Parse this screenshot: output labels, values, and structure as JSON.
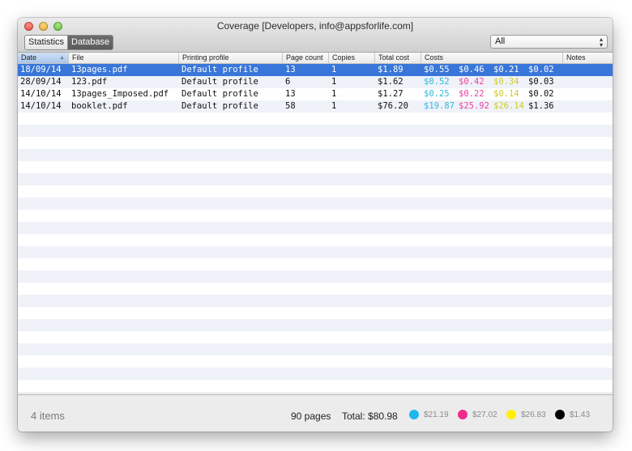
{
  "window": {
    "title": "Coverage [Developers, info@appsforlife.com]"
  },
  "toolbar": {
    "segments": [
      {
        "label": "Statistics",
        "selected": false
      },
      {
        "label": "Database",
        "selected": true
      }
    ],
    "filter": {
      "selected": "All"
    }
  },
  "table": {
    "columns": [
      {
        "label": "Date",
        "sorted": "ascending"
      },
      {
        "label": "File"
      },
      {
        "label": "Printing profile"
      },
      {
        "label": "Page count"
      },
      {
        "label": "Copies"
      },
      {
        "label": "Total cost"
      },
      {
        "label": "Costs"
      },
      {
        "label": "Notes"
      }
    ],
    "rows": [
      {
        "date": "18/09/14",
        "file": "13pages.pdf",
        "profile": "Default profile",
        "pages": "13",
        "copies": "1",
        "total": "$1.89",
        "cyan": "$0.55",
        "magenta": "$0.46",
        "yellow": "$0.21",
        "black": "$0.02",
        "notes": "",
        "selected": true
      },
      {
        "date": "28/09/14",
        "file": "123.pdf",
        "profile": "Default profile",
        "pages": "6",
        "copies": "1",
        "total": "$1.62",
        "cyan": "$0.52",
        "magenta": "$0.42",
        "yellow": "$0.34",
        "black": "$0.03",
        "notes": ""
      },
      {
        "date": "14/10/14",
        "file": "13pages_Imposed.pdf",
        "profile": "Default profile",
        "pages": "13",
        "copies": "1",
        "total": "$1.27",
        "cyan": "$0.25",
        "magenta": "$0.22",
        "yellow": "$0.14",
        "black": "$0.02",
        "notes": ""
      },
      {
        "date": "14/10/14",
        "file": "booklet.pdf",
        "profile": "Default profile",
        "pages": "58",
        "copies": "1",
        "total": "$76.20",
        "cyan": "$19.87",
        "magenta": "$25.92",
        "yellow": "$26.14",
        "black": "$1.36",
        "notes": ""
      }
    ]
  },
  "status": {
    "items_count": "4 items",
    "pages": "90 pages",
    "total": "Total: $80.98",
    "inks": [
      {
        "name": "cyan",
        "color": "#1fb8ec",
        "amount": "$21.19"
      },
      {
        "name": "magenta",
        "color": "#ee2c8c",
        "amount": "$27.02"
      },
      {
        "name": "yellow",
        "color": "#fff200",
        "amount": "$26.83"
      },
      {
        "name": "black",
        "color": "#000000",
        "amount": "$1.43"
      }
    ]
  },
  "colors": {
    "selection": "#3876d9",
    "stripe": "#eff2f8",
    "cyan_text": "#2cb9e0",
    "magenta_text": "#ef3fa0",
    "yellow_text": "#cfcc22"
  }
}
